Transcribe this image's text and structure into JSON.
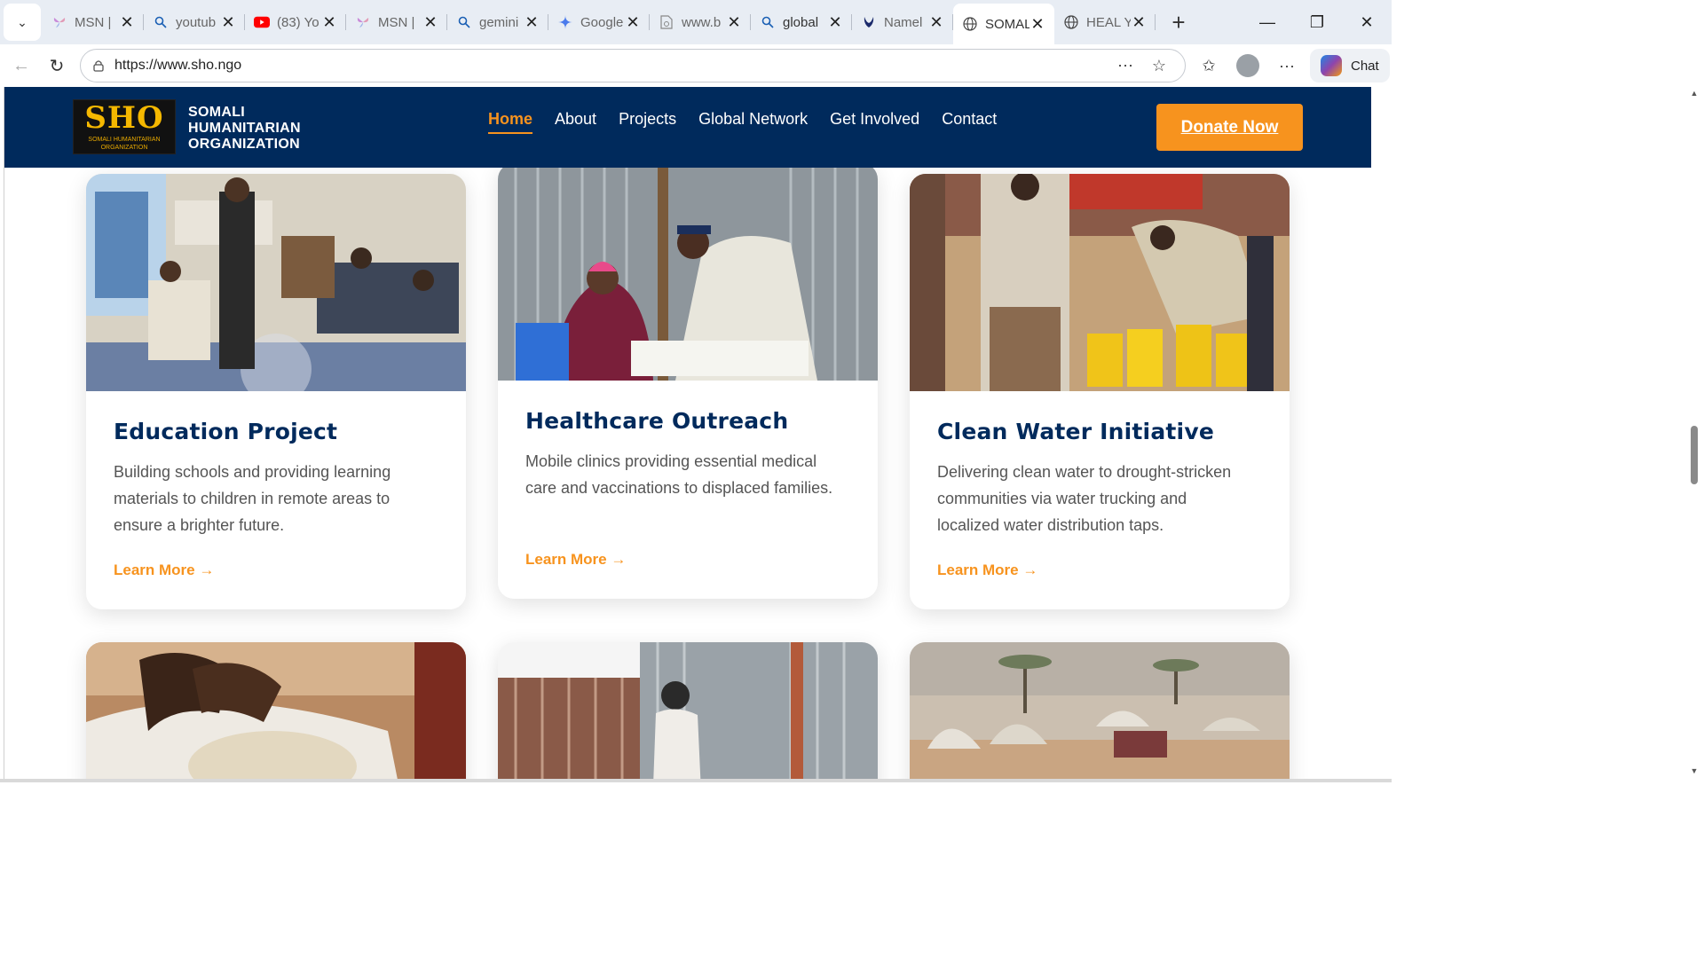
{
  "browser": {
    "tabs": [
      {
        "title": "MSN |",
        "icon": "msn-icon"
      },
      {
        "title": "youtub",
        "icon": "search-icon"
      },
      {
        "title": "(83) Yo",
        "icon": "youtube-icon"
      },
      {
        "title": "MSN |",
        "icon": "msn-icon"
      },
      {
        "title": "gemini",
        "icon": "search-icon"
      },
      {
        "title": "Google",
        "icon": "gemini-icon"
      },
      {
        "title": "www.b",
        "icon": "blocked-page-icon"
      },
      {
        "title": "global",
        "icon": "search-icon"
      },
      {
        "title": "Namel",
        "icon": "hands-logo-icon"
      },
      {
        "title": "SOMAL",
        "icon": "globe-icon",
        "active": true
      },
      {
        "title": "HEAL Y",
        "icon": "globe-icon"
      }
    ],
    "url": "https://www.sho.ngo",
    "chat_label": "Chat"
  },
  "site": {
    "logo_text": "SHO",
    "logo_subtext": "SOMALI HUMANITARIAN ORGANIZATION",
    "org_name_line1": "SOMALI",
    "org_name_line2": "HUMANITARIAN",
    "org_name_line3": "ORGANIZATION",
    "nav": [
      "Home",
      "About",
      "Projects",
      "Global Network",
      "Get Involved",
      "Contact"
    ],
    "active_nav": "Home",
    "donate_label": "Donate Now",
    "accent_color": "#f7931e",
    "header_color": "#002a5c"
  },
  "projects": [
    {
      "title": "Education Project",
      "description": "Building schools and providing learning materials to children in remote areas to ensure a brighter future.",
      "link": "Learn More →"
    },
    {
      "title": "Healthcare Outreach",
      "description": "Mobile clinics providing essential medical care and vaccinations to displaced families.",
      "link": "Learn More →"
    },
    {
      "title": "Clean Water Initiative",
      "description": "Delivering clean water to drought-stricken communities via water trucking and localized water distribution taps.",
      "link": "Learn More →"
    }
  ]
}
